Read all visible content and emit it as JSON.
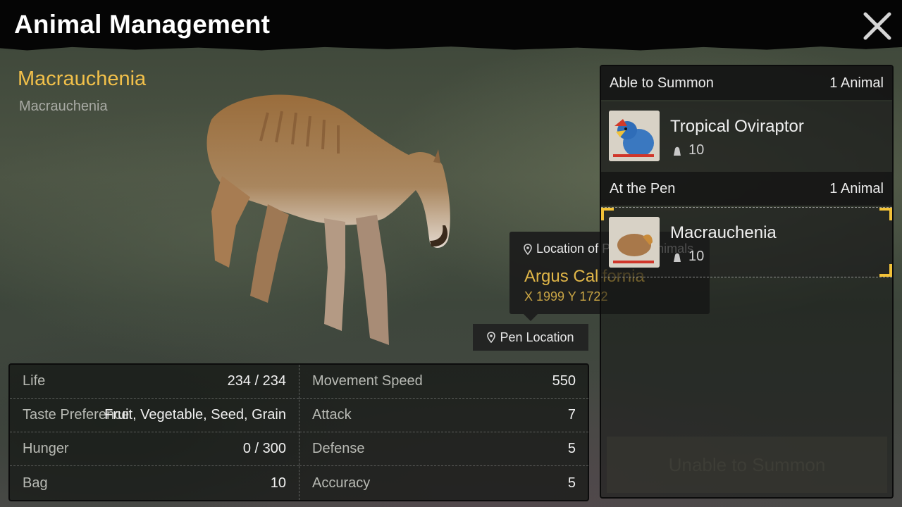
{
  "header": {
    "title": "Animal Management"
  },
  "animal": {
    "name": "Macrauchenia",
    "species": "Macrauchenia"
  },
  "stats": {
    "left": [
      {
        "label": "Life",
        "value": "234 / 234"
      },
      {
        "label": "Taste Preference",
        "value": "Fruit, Vegetable, Seed, Grain"
      },
      {
        "label": "Hunger",
        "value": "0 / 300"
      },
      {
        "label": "Bag",
        "value": "10"
      }
    ],
    "right": [
      {
        "label": "Movement Speed",
        "value": "550"
      },
      {
        "label": "Attack",
        "value": "7"
      },
      {
        "label": "Defense",
        "value": "5"
      },
      {
        "label": "Accuracy",
        "value": "5"
      }
    ]
  },
  "pen_button": {
    "label": "Pen Location",
    "icon": "pin-icon"
  },
  "tooltip": {
    "header": "Location of Penned Animals",
    "place": "Argus California",
    "coords": "X 1999 Y 1722"
  },
  "panel": {
    "summon_section": {
      "title": "Able to Summon",
      "count": "1 Animal"
    },
    "summon_animals": [
      {
        "name": "Tropical Oviraptor",
        "level": "10"
      }
    ],
    "pen_section": {
      "title": "At the Pen",
      "count": "1 Animal"
    },
    "pen_animals": [
      {
        "name": "Macrauchenia",
        "level": "10"
      }
    ],
    "summon_button": "Unable to Summon"
  },
  "colors": {
    "accent": "#f2c04a",
    "health_bar": "#d0362a",
    "selection": "#f2c238"
  }
}
